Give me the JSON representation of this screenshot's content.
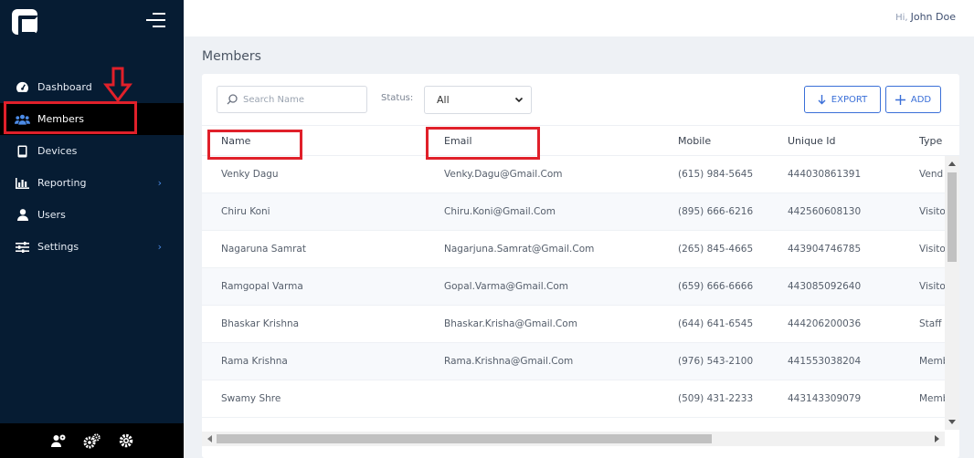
{
  "header": {
    "greeting": "Hi,",
    "user": "John Doe"
  },
  "page": {
    "title": "Members"
  },
  "sidebar": {
    "items": [
      {
        "label": "Dashboard",
        "icon": "dashboard-icon"
      },
      {
        "label": "Members",
        "icon": "users-icon",
        "active": true
      },
      {
        "label": "Devices",
        "icon": "tablet-icon"
      },
      {
        "label": "Reporting",
        "icon": "bar-chart-icon",
        "submenu": true
      },
      {
        "label": "Users",
        "icon": "user-icon"
      },
      {
        "label": "Settings",
        "icon": "sliders-icon",
        "submenu": true
      }
    ],
    "footer_icons": [
      "user-settings-icon",
      "gears-icon",
      "gear-icon"
    ]
  },
  "toolbar": {
    "search_placeholder": "Search Name",
    "status_label": "Status:",
    "status_value": "All",
    "export_label": "EXPORT",
    "add_label": "ADD"
  },
  "table": {
    "columns": [
      "Name",
      "Email",
      "Mobile",
      "Unique Id",
      "Type"
    ],
    "rows": [
      {
        "name": "Venky Dagu",
        "email": "Venky.Dagu@Gmail.Com",
        "mobile": "(615) 984-5645",
        "uid": "444030861391",
        "type": "Vend"
      },
      {
        "name": "Chiru Koni",
        "email": "Chiru.Koni@Gmail.Com",
        "mobile": "(895) 666-6216",
        "uid": "442560608130",
        "type": "Visito"
      },
      {
        "name": "Nagaruna Samrat",
        "email": "Nagarjuna.Samrat@Gmail.Com",
        "mobile": "(265) 845-4665",
        "uid": "443904746785",
        "type": "Visito"
      },
      {
        "name": "Ramgopal Varma",
        "email": "Gopal.Varma@Gmail.Com",
        "mobile": "(659) 666-6666",
        "uid": "443085092640",
        "type": "Visito"
      },
      {
        "name": "Bhaskar Krishna",
        "email": "Bhaskar.Krisha@Gmail.Com",
        "mobile": "(644) 641-6545",
        "uid": "444206200036",
        "type": "Staff"
      },
      {
        "name": "Rama Krishna",
        "email": "Rama.Krishna@Gmail.Com",
        "mobile": "(976) 543-2100",
        "uid": "441553038204",
        "type": "Memb"
      },
      {
        "name": "Swamy Shre",
        "email": "",
        "mobile": "(509) 431-2233",
        "uid": "443143309079",
        "type": "Memb"
      }
    ]
  },
  "colors": {
    "sidebar_bg": "#061c33",
    "accent": "#3a6fd8",
    "annotation": "#e0202a"
  }
}
